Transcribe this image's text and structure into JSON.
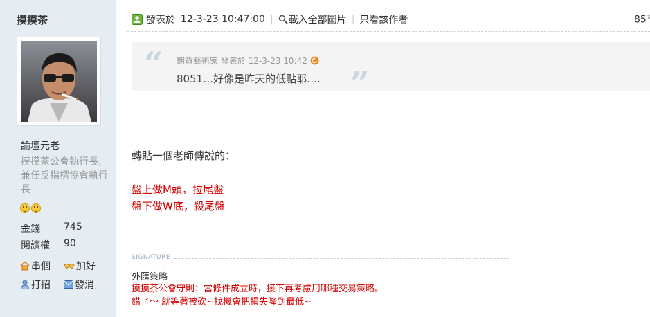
{
  "author": {
    "name": "摸摸茶",
    "rank": "論壇元老",
    "custom_title": "摸摸茶公會執行長,兼任反指標協會執行長",
    "stats": [
      {
        "label": "金錢",
        "value": "745"
      },
      {
        "label": "閱讀權",
        "value": "90"
      }
    ],
    "actions": {
      "visit": "串個",
      "add_friend": "加好",
      "poke": "打招",
      "message": "發消"
    },
    "avatar_icon": "user-avatar-photo",
    "emote_icons": [
      "smiley-icon",
      "smiley-icon"
    ]
  },
  "post": {
    "posted_label": "發表於",
    "posted_time": "12-3-23 10:47:00",
    "load_images": "載入全部圖片",
    "author_only": "只看該作者",
    "floor_number": "85",
    "floor_symbol": "#",
    "quote": {
      "open_mark": "“",
      "close_mark": "”",
      "meta": "期貨藝術家 發表於 12-3-23 10:42",
      "text": "8051…好像是昨天的低點耶…."
    },
    "content": {
      "intro": "轉貼一個老師傳說的：",
      "line1": "盤上做M頭，拉尾盤",
      "line2": "盤下做W底，殺尾盤"
    },
    "signature": {
      "label": "SIGNATURE",
      "title": "外匯策略",
      "line1": "摸摸茶公會守則：當條件成立時，接下再考慮用哪種交易策略。",
      "line2": "錯了～ 就等著被砍~找機會把損失降到最低~"
    }
  },
  "colors": {
    "sidebar_bg": "#e5edf2",
    "highlight_red": "#d40000",
    "quote_bg": "#f4f4f4",
    "muted_text": "#999999"
  }
}
